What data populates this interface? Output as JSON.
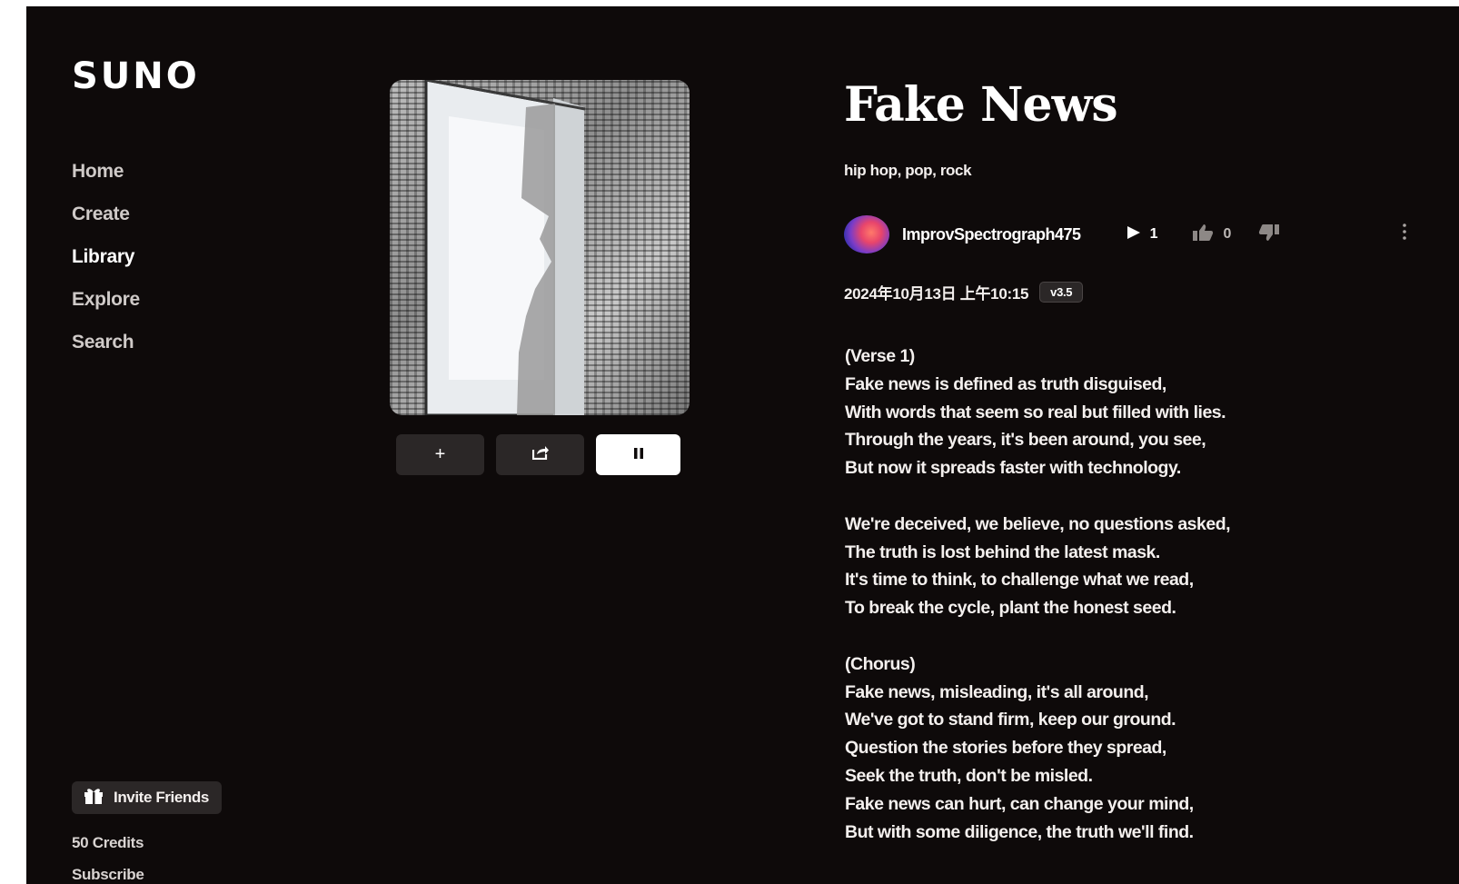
{
  "sidebar": {
    "logo": "SUNO",
    "nav": [
      {
        "label": "Home",
        "active": false
      },
      {
        "label": "Create",
        "active": false
      },
      {
        "label": "Library",
        "active": true
      },
      {
        "label": "Explore",
        "active": false
      },
      {
        "label": "Search",
        "active": false
      }
    ],
    "invite_label": "Invite Friends",
    "credits": "50 Credits",
    "subscribe": "Subscribe"
  },
  "cover_actions": {
    "add_icon": "plus-icon",
    "share_icon": "share-icon",
    "pause_icon": "pause-icon",
    "add_glyph": "+",
    "share_glyph": "↗",
    "pause_glyph": "❚❚"
  },
  "song": {
    "title": "Fake News",
    "genres": "hip hop, pop, rock",
    "artist": "ImprovSpectrograph475",
    "plays": "1",
    "likes": "0",
    "date": "2024年10月13日 上午10:15",
    "version": "v3.5"
  },
  "lyrics": {
    "stanzas": [
      [
        "(Verse 1)",
        "Fake news is defined as truth disguised,",
        "With words that seem so real but filled with lies.",
        "Through the years, it's been around, you see,",
        "But now it spreads faster with technology."
      ],
      [
        "We're deceived, we believe, no questions asked,",
        "The truth is lost behind the latest mask.",
        "It's time to think, to challenge what we read,",
        "To break the cycle, plant the honest seed."
      ],
      [
        "(Chorus)",
        "Fake news, misleading, it's all around,",
        "We've got to stand firm, keep our ground.",
        "Question the stories before they spread,",
        "Seek the truth, don't be misled.",
        "Fake news can hurt, can change your mind,",
        "But with some diligence, the truth we'll find."
      ]
    ]
  },
  "colors": {
    "background": "#0e0a0a",
    "button_bg": "#2b2727",
    "text": "#f4f0ee"
  }
}
